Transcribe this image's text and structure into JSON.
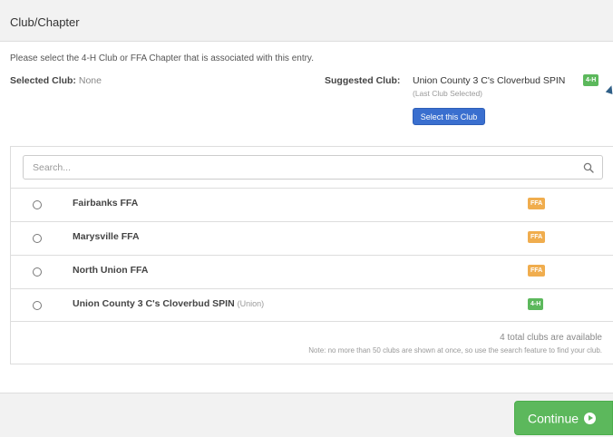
{
  "header": {
    "title": "Club/Chapter"
  },
  "instructions": "Please select the 4-H Club or FFA Chapter that is associated with this entry.",
  "selected_club": {
    "label": "Selected Club:",
    "value": "None"
  },
  "suggested_club": {
    "label": "Suggested Club:",
    "name": "Union County 3 C's Cloverbud SPIN",
    "badge": "4-H",
    "subtext": "(Last Club Selected)",
    "button_label": "Select this Club"
  },
  "search": {
    "placeholder": "Search...",
    "value": ""
  },
  "clubs": [
    {
      "name": "Fairbanks FFA",
      "suffix": "",
      "badge": "FFA",
      "badge_color": "#f0ad4e",
      "selected": false
    },
    {
      "name": "Marysville FFA",
      "suffix": "",
      "badge": "FFA",
      "badge_color": "#f0ad4e",
      "selected": false
    },
    {
      "name": "North Union FFA",
      "suffix": "",
      "badge": "FFA",
      "badge_color": "#f0ad4e",
      "selected": false
    },
    {
      "name": "Union County 3 C's Cloverbud SPIN",
      "suffix": "(Union)",
      "badge": "4-H",
      "badge_color": "#5cb85c",
      "selected": false
    }
  ],
  "footer": {
    "count_text": "4 total clubs are available",
    "note": "Note: no more than 50 clubs are shown at once, so use the search feature to find your club."
  },
  "continue_button": {
    "label": "Continue",
    "icon": "arrow-circle-right-icon"
  },
  "colors": {
    "green": "#5cb85c",
    "orange": "#f0ad4e",
    "blue": "#3a6fcf"
  }
}
